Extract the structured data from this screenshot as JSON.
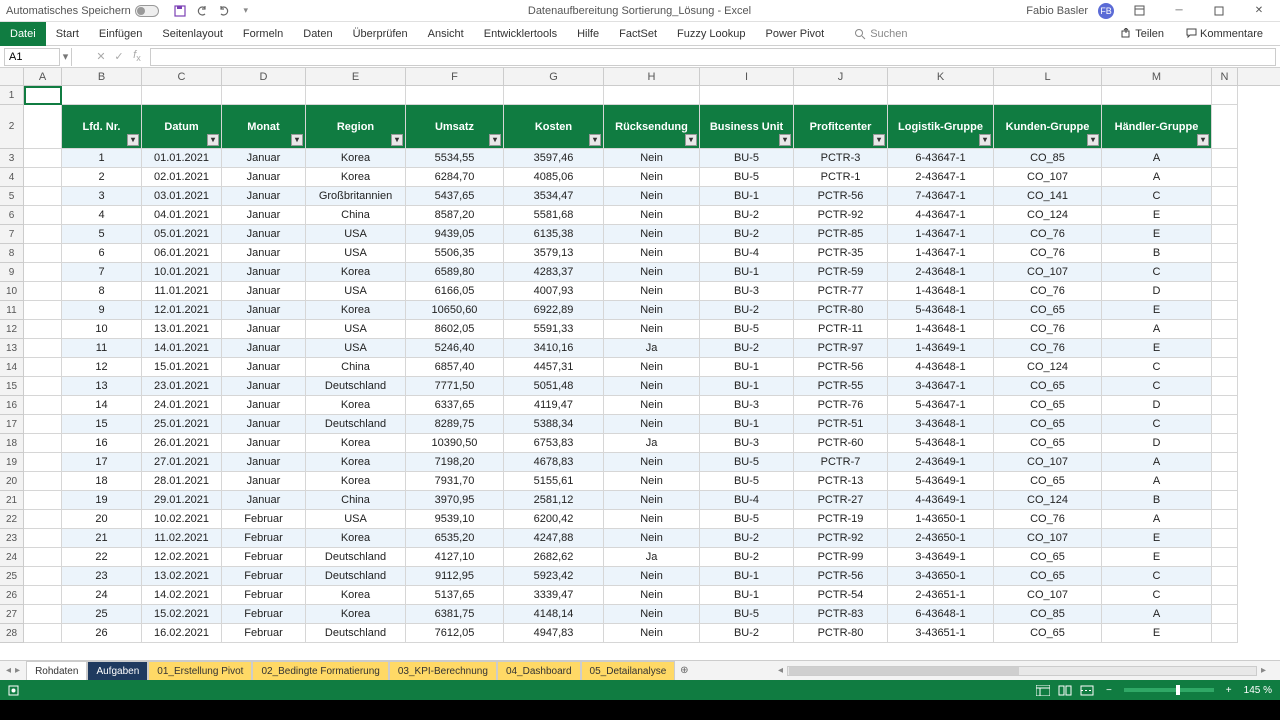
{
  "titlebar": {
    "autosave_label": "Automatisches Speichern",
    "doc_title": "Datenaufbereitung Sortierung_Lösung - Excel",
    "user_name": "Fabio Basler",
    "user_initials": "FB"
  },
  "ribbon": {
    "tabs": [
      "Datei",
      "Start",
      "Einfügen",
      "Seitenlayout",
      "Formeln",
      "Daten",
      "Überprüfen",
      "Ansicht",
      "Entwicklertools",
      "Hilfe",
      "FactSet",
      "Fuzzy Lookup",
      "Power Pivot"
    ],
    "search_placeholder": "Suchen",
    "share_label": "Teilen",
    "comments_label": "Kommentare"
  },
  "formula_bar": {
    "name_box": "A1",
    "formula": ""
  },
  "columns": [
    "A",
    "B",
    "C",
    "D",
    "E",
    "F",
    "G",
    "H",
    "I",
    "J",
    "K",
    "L",
    "M",
    "N"
  ],
  "table": {
    "headers": [
      "Lfd. Nr.",
      "Datum",
      "Monat",
      "Region",
      "Umsatz",
      "Kosten",
      "Rücksendung",
      "Business Unit",
      "Profitcenter",
      "Logistik-Gruppe",
      "Kunden-Gruppe",
      "Händler-Gruppe"
    ],
    "rows": [
      [
        "1",
        "01.01.2021",
        "Januar",
        "Korea",
        "5534,55",
        "3597,46",
        "Nein",
        "BU-5",
        "PCTR-3",
        "6-43647-1",
        "CO_85",
        "A"
      ],
      [
        "2",
        "02.01.2021",
        "Januar",
        "Korea",
        "6284,70",
        "4085,06",
        "Nein",
        "BU-5",
        "PCTR-1",
        "2-43647-1",
        "CO_107",
        "A"
      ],
      [
        "3",
        "03.01.2021",
        "Januar",
        "Großbritannien",
        "5437,65",
        "3534,47",
        "Nein",
        "BU-1",
        "PCTR-56",
        "7-43647-1",
        "CO_141",
        "C"
      ],
      [
        "4",
        "04.01.2021",
        "Januar",
        "China",
        "8587,20",
        "5581,68",
        "Nein",
        "BU-2",
        "PCTR-92",
        "4-43647-1",
        "CO_124",
        "E"
      ],
      [
        "5",
        "05.01.2021",
        "Januar",
        "USA",
        "9439,05",
        "6135,38",
        "Nein",
        "BU-2",
        "PCTR-85",
        "1-43647-1",
        "CO_76",
        "E"
      ],
      [
        "6",
        "06.01.2021",
        "Januar",
        "USA",
        "5506,35",
        "3579,13",
        "Nein",
        "BU-4",
        "PCTR-35",
        "1-43647-1",
        "CO_76",
        "B"
      ],
      [
        "7",
        "10.01.2021",
        "Januar",
        "Korea",
        "6589,80",
        "4283,37",
        "Nein",
        "BU-1",
        "PCTR-59",
        "2-43648-1",
        "CO_107",
        "C"
      ],
      [
        "8",
        "11.01.2021",
        "Januar",
        "USA",
        "6166,05",
        "4007,93",
        "Nein",
        "BU-3",
        "PCTR-77",
        "1-43648-1",
        "CO_76",
        "D"
      ],
      [
        "9",
        "12.01.2021",
        "Januar",
        "Korea",
        "10650,60",
        "6922,89",
        "Nein",
        "BU-2",
        "PCTR-80",
        "5-43648-1",
        "CO_65",
        "E"
      ],
      [
        "10",
        "13.01.2021",
        "Januar",
        "USA",
        "8602,05",
        "5591,33",
        "Nein",
        "BU-5",
        "PCTR-11",
        "1-43648-1",
        "CO_76",
        "A"
      ],
      [
        "11",
        "14.01.2021",
        "Januar",
        "USA",
        "5246,40",
        "3410,16",
        "Ja",
        "BU-2",
        "PCTR-97",
        "1-43649-1",
        "CO_76",
        "E"
      ],
      [
        "12",
        "15.01.2021",
        "Januar",
        "China",
        "6857,40",
        "4457,31",
        "Nein",
        "BU-1",
        "PCTR-56",
        "4-43648-1",
        "CO_124",
        "C"
      ],
      [
        "13",
        "23.01.2021",
        "Januar",
        "Deutschland",
        "7771,50",
        "5051,48",
        "Nein",
        "BU-1",
        "PCTR-55",
        "3-43647-1",
        "CO_65",
        "C"
      ],
      [
        "14",
        "24.01.2021",
        "Januar",
        "Korea",
        "6337,65",
        "4119,47",
        "Nein",
        "BU-3",
        "PCTR-76",
        "5-43647-1",
        "CO_65",
        "D"
      ],
      [
        "15",
        "25.01.2021",
        "Januar",
        "Deutschland",
        "8289,75",
        "5388,34",
        "Nein",
        "BU-1",
        "PCTR-51",
        "3-43648-1",
        "CO_65",
        "C"
      ],
      [
        "16",
        "26.01.2021",
        "Januar",
        "Korea",
        "10390,50",
        "6753,83",
        "Ja",
        "BU-3",
        "PCTR-60",
        "5-43648-1",
        "CO_65",
        "D"
      ],
      [
        "17",
        "27.01.2021",
        "Januar",
        "Korea",
        "7198,20",
        "4678,83",
        "Nein",
        "BU-5",
        "PCTR-7",
        "2-43649-1",
        "CO_107",
        "A"
      ],
      [
        "18",
        "28.01.2021",
        "Januar",
        "Korea",
        "7931,70",
        "5155,61",
        "Nein",
        "BU-5",
        "PCTR-13",
        "5-43649-1",
        "CO_65",
        "A"
      ],
      [
        "19",
        "29.01.2021",
        "Januar",
        "China",
        "3970,95",
        "2581,12",
        "Nein",
        "BU-4",
        "PCTR-27",
        "4-43649-1",
        "CO_124",
        "B"
      ],
      [
        "20",
        "10.02.2021",
        "Februar",
        "USA",
        "9539,10",
        "6200,42",
        "Nein",
        "BU-5",
        "PCTR-19",
        "1-43650-1",
        "CO_76",
        "A"
      ],
      [
        "21",
        "11.02.2021",
        "Februar",
        "Korea",
        "6535,20",
        "4247,88",
        "Nein",
        "BU-2",
        "PCTR-92",
        "2-43650-1",
        "CO_107",
        "E"
      ],
      [
        "22",
        "12.02.2021",
        "Februar",
        "Deutschland",
        "4127,10",
        "2682,62",
        "Ja",
        "BU-2",
        "PCTR-99",
        "3-43649-1",
        "CO_65",
        "E"
      ],
      [
        "23",
        "13.02.2021",
        "Februar",
        "Deutschland",
        "9112,95",
        "5923,42",
        "Nein",
        "BU-1",
        "PCTR-56",
        "3-43650-1",
        "CO_65",
        "C"
      ],
      [
        "24",
        "14.02.2021",
        "Februar",
        "Korea",
        "5137,65",
        "3339,47",
        "Nein",
        "BU-1",
        "PCTR-54",
        "2-43651-1",
        "CO_107",
        "C"
      ],
      [
        "25",
        "15.02.2021",
        "Februar",
        "Korea",
        "6381,75",
        "4148,14",
        "Nein",
        "BU-5",
        "PCTR-83",
        "6-43648-1",
        "CO_85",
        "A"
      ],
      [
        "26",
        "16.02.2021",
        "Februar",
        "Deutschland",
        "7612,05",
        "4947,83",
        "Nein",
        "BU-2",
        "PCTR-80",
        "3-43651-1",
        "CO_65",
        "E"
      ]
    ]
  },
  "sheets": {
    "tabs": [
      {
        "label": "Rohdaten",
        "style": "normal"
      },
      {
        "label": "Aufgaben",
        "style": "active"
      },
      {
        "label": "01_Erstellung Pivot",
        "style": "yellow"
      },
      {
        "label": "02_Bedingte Formatierung",
        "style": "yellow"
      },
      {
        "label": "03_KPI-Berechnung",
        "style": "yellow"
      },
      {
        "label": "04_Dashboard",
        "style": "yellow"
      },
      {
        "label": "05_Detailanalyse",
        "style": "yellow"
      }
    ]
  },
  "statusbar": {
    "zoom": "145 %"
  }
}
